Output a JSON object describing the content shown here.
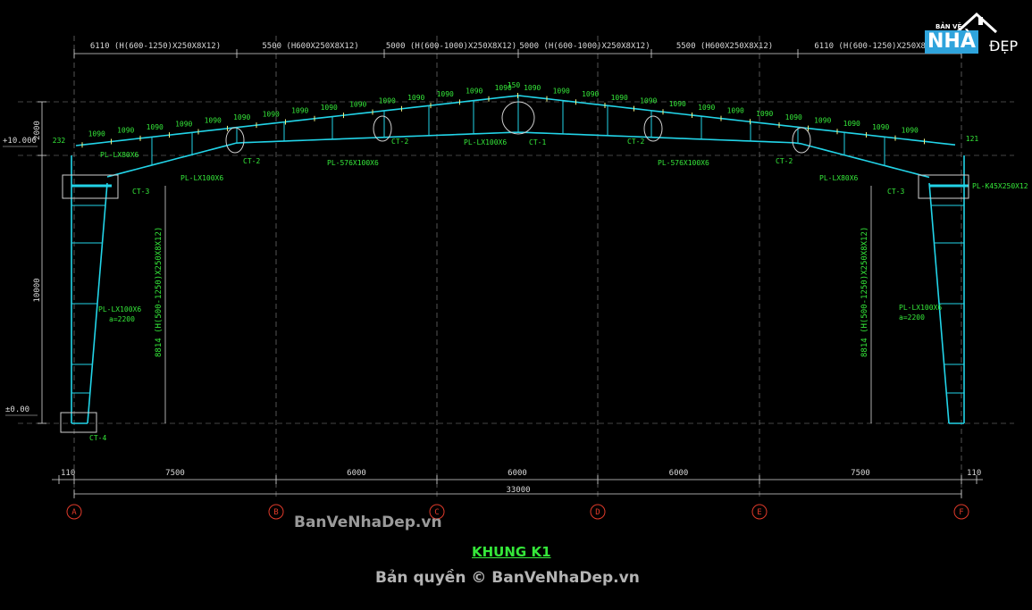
{
  "drawing_title": "KHUNG K1",
  "watermark": "BanVeNhaDep.vn",
  "copyright": "Bản quyền © BanVeNhaDep.vn",
  "logo": {
    "top": "BẢN VẼ",
    "main": "NHÀ",
    "sub": "ĐẸP"
  },
  "top_dims": [
    "6110 (H(600-1250)X250X8X12)",
    "5500 (H600X250X8X12)",
    "5000 (H(600-1000)X250X8X12)",
    "5000 (H(600-1000)X250X8X12)",
    "5500 (H600X250X8X12)",
    "6110 (H(600-1250)X250X8X12)"
  ],
  "purlin_spacing": "1090",
  "purlin_end_left": "232",
  "purlin_end_right": "121",
  "ridge_gap": "150",
  "left_dims": {
    "rise": "2000",
    "column": "10000",
    "top_level": "+10.000",
    "ground": "±0.00"
  },
  "bottom_dims": {
    "edge": "110",
    "spans": [
      "7500",
      "6000",
      "6000",
      "6000",
      "7500"
    ],
    "total": "33000"
  },
  "axes": [
    "A",
    "B",
    "C",
    "D",
    "E",
    "F"
  ],
  "column_labels": {
    "left": "8814 (H(500-1250)X250X8X12)",
    "right": "8814 (H(500-1250)X250X8X12)"
  },
  "plate_labels": {
    "col_stiff": "PL-LX100X6",
    "col_spacing": "a=2200",
    "rafter_top_left": "PL-LX80X6",
    "rafter_left": "PL-LX100X6",
    "rafter_mid": "PL-576X100X6",
    "ridge": "PL-LX100X6",
    "rafter_right": "PL-LX80X6",
    "end_plate_right": "PL-K45X250X12"
  },
  "detail_labels": {
    "ridge": "CT-1",
    "splice": "CT-2",
    "knee": "CT-3",
    "base": "CT-4"
  },
  "colors": {
    "member": "#22d4e8",
    "dim": "#d8d8d8",
    "label": "#35e83a",
    "axis": "#e03a2a",
    "logo_blue": "#2fa4dc"
  }
}
